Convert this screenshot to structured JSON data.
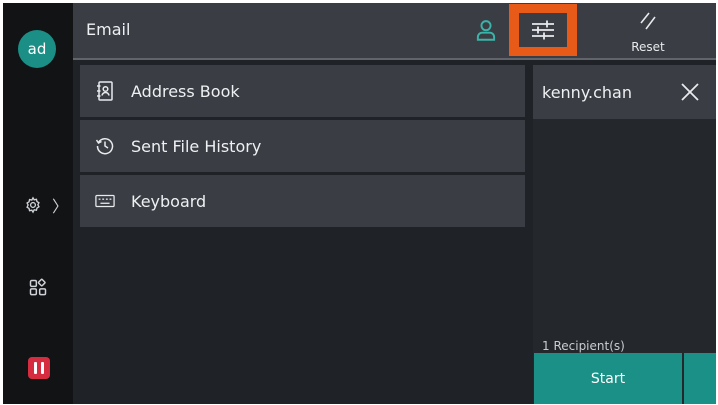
{
  "user": {
    "initials": "ad"
  },
  "header": {
    "title": "Email",
    "reset_label": "Reset"
  },
  "menu": [
    {
      "label": "Address Book",
      "icon": "address-book-icon"
    },
    {
      "label": "Sent File History",
      "icon": "history-icon"
    },
    {
      "label": "Keyboard",
      "icon": "keyboard-icon"
    }
  ],
  "recipients": [
    {
      "name": "kenny.chan"
    }
  ],
  "recipient_count": "1 Recipient(s)",
  "start_label": "Start",
  "colors": {
    "accent": "#1a9086",
    "highlight": "#e85a18",
    "stop": "#d52c3f",
    "background": "#1f2226",
    "panel": "#3a3e44"
  }
}
